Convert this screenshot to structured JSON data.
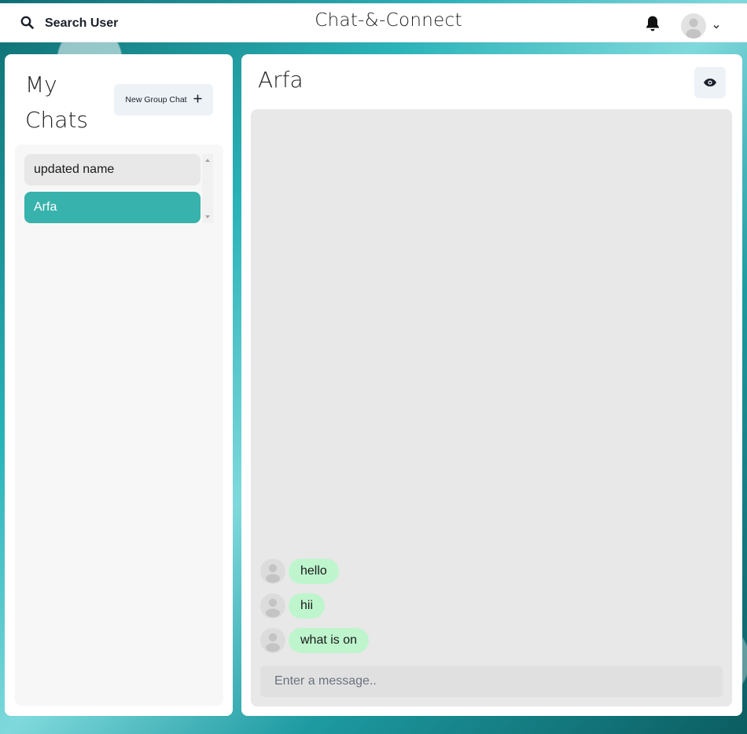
{
  "header": {
    "search_label": "Search User",
    "app_title": "Chat-&-Connect"
  },
  "sidebar": {
    "title_line1": "My",
    "title_line2": "Chats",
    "new_group_label": "New Group Chat",
    "chats": [
      {
        "name": "updated name",
        "active": false
      },
      {
        "name": "Arfa",
        "active": true
      }
    ]
  },
  "chat": {
    "title": "Arfa",
    "messages": [
      {
        "text": "hello"
      },
      {
        "text": "hii"
      },
      {
        "text": "what is on"
      }
    ],
    "input_placeholder": "Enter a message.."
  },
  "colors": {
    "accent": "#38b2ac",
    "bubble": "#bef5cd",
    "button_bg": "#edf2f7"
  }
}
